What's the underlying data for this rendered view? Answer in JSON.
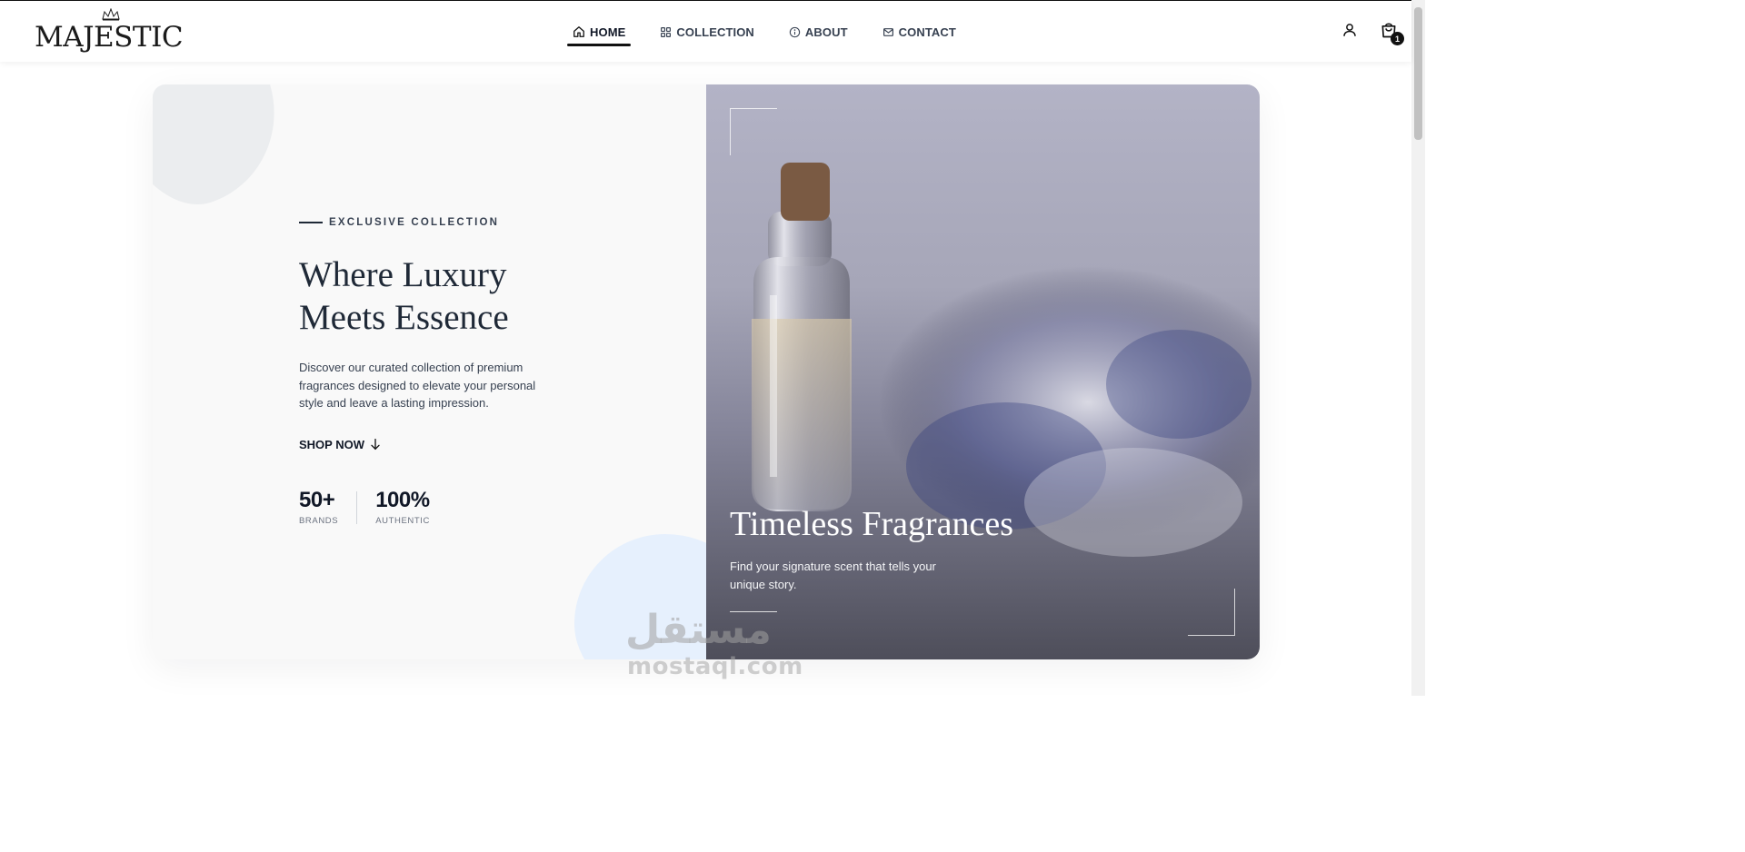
{
  "brand": {
    "logo_text": "MAJESTIC"
  },
  "nav": {
    "items": [
      {
        "label": "HOME",
        "icon": "home-icon",
        "active": true
      },
      {
        "label": "COLLECTION",
        "icon": "grid-icon",
        "active": false
      },
      {
        "label": "ABOUT",
        "icon": "info-icon",
        "active": false
      },
      {
        "label": "CONTACT",
        "icon": "mail-icon",
        "active": false
      }
    ]
  },
  "header_actions": {
    "user_icon": "user-icon",
    "cart_icon": "shopping-bag-icon",
    "cart_count": "1"
  },
  "hero": {
    "eyebrow": "EXCLUSIVE COLLECTION",
    "headline_line1": "Where Luxury",
    "headline_line2": "Meets Essence",
    "description": "Discover our curated collection of premium fragrances designed to elevate your personal style and leave a lasting impression.",
    "cta_label": "SHOP NOW",
    "stats": [
      {
        "value": "50+",
        "label": "BRANDS"
      },
      {
        "value": "100%",
        "label": "AUTHENTIC"
      }
    ],
    "image_title": "Timeless Fragrances",
    "image_subtitle": "Find your signature scent that tells your unique story."
  },
  "watermark": {
    "arabic": "مستقل",
    "latin": "mostaql.com"
  },
  "colors": {
    "text_dark": "#111827",
    "blob_blue": "#e6f0fd",
    "blob_gray": "#ebedef",
    "image_bg": "#a6a6b8"
  }
}
